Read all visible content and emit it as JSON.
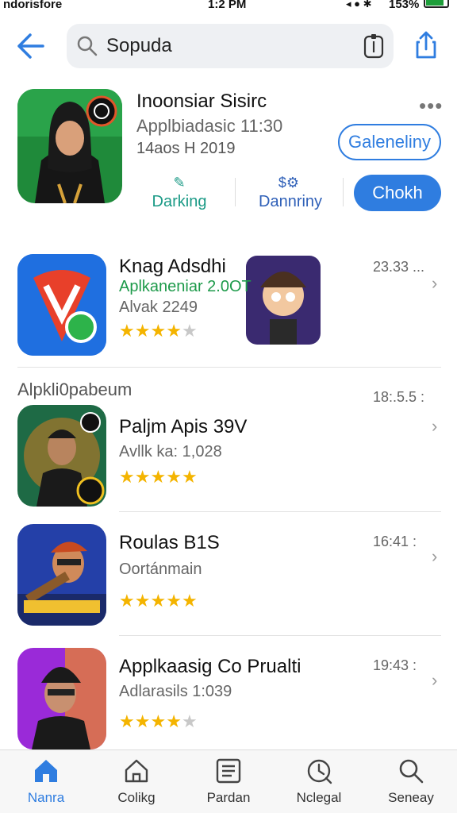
{
  "status_bar": {
    "carrier": "ndorisfore",
    "time": "1:2 PM",
    "battery_pct": "153%"
  },
  "search": {
    "value": "Sopuda",
    "placeholder": "Sopuda"
  },
  "featured": {
    "title": "Inoonsiar Sisirc",
    "subtitle": "Applbiadasic 11:30",
    "meta": "14aos H 2019",
    "more_label": "•••",
    "outline_button": "Galeneliny",
    "fill_button": "Chokh",
    "stat1": {
      "icon": "✎",
      "label": "Darking"
    },
    "stat2": {
      "icon": "$⚙",
      "label": "Dannriny"
    }
  },
  "section_title": "Alpkli0pabeum",
  "apps": [
    {
      "name": "Knag Adsdhi",
      "subtitle": "Aplkaneniar 2.0OT",
      "subtitle2": "Alvak 2249",
      "rating": 3.5,
      "time": "23.33 ...",
      "icon": "map-pin-icon",
      "accent": "#2a7be4"
    },
    {
      "name": "Paljm Apis 39V",
      "subtitle": "Avllk ka: 1,028",
      "subtitle2": "",
      "rating": 4.5,
      "time": "18:.5.5 :",
      "icon": "avatar-icon",
      "accent": "#1f7a4a"
    },
    {
      "name": "Roulas B1S",
      "subtitle": "Oortánmain",
      "subtitle2": "",
      "rating": 4.5,
      "time": "16:41 :",
      "icon": "avatar-icon",
      "accent": "#2a4fb8"
    },
    {
      "name": "Applkaasig Co Prualti",
      "subtitle": "Adlarasils 1:039",
      "subtitle2": "",
      "rating": 4,
      "time": "19:43 :",
      "icon": "avatar-icon",
      "accent": "#8a2fd0"
    }
  ],
  "tabs": [
    {
      "label": "Nanra",
      "icon": "home-icon",
      "active": true
    },
    {
      "label": "Colikg",
      "icon": "house-outline-icon",
      "active": false
    },
    {
      "label": "Pardan",
      "icon": "list-icon",
      "active": false
    },
    {
      "label": "Nclegal",
      "icon": "clock-icon",
      "active": false
    },
    {
      "label": "Seneay",
      "icon": "search-icon",
      "active": false
    }
  ],
  "colors": {
    "accent": "#2f7de0",
    "star": "#f4b400",
    "star_off": "#c8c8c8"
  }
}
